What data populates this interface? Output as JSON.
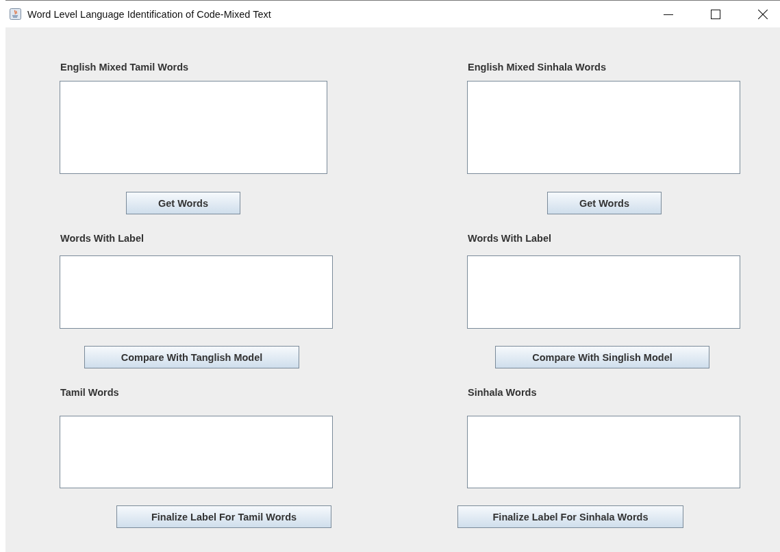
{
  "window": {
    "title": "Word Level Language Identification of Code-Mixed Text"
  },
  "columns": [
    {
      "sections": [
        {
          "label": "English Mixed Tamil Words",
          "button": "Get Words"
        },
        {
          "label": "Words With Label",
          "button": "Compare With Tanglish Model"
        },
        {
          "label": "Tamil Words",
          "button": "Finalize Label For Tamil Words"
        }
      ]
    },
    {
      "sections": [
        {
          "label": "English Mixed Sinhala Words",
          "button": "Get Words"
        },
        {
          "label": "Words With Label",
          "button": "Compare With Singlish Model"
        },
        {
          "label": "Sinhala Words",
          "button": "Finalize Label For Sinhala Words"
        }
      ]
    }
  ]
}
